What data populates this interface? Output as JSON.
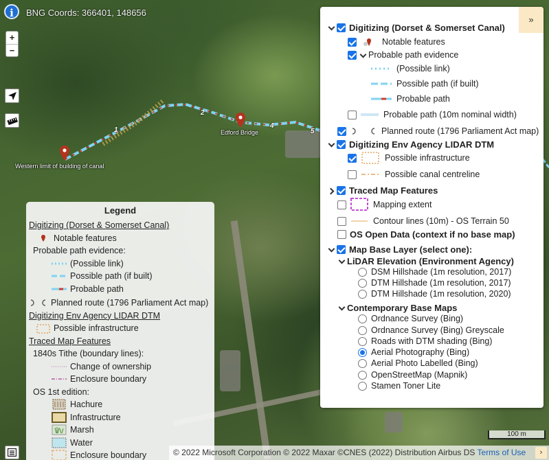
{
  "map": {
    "coords_text": "BNG Coords: 366401, 148656",
    "zoom_in": "+",
    "zoom_out": "−",
    "labels": {
      "western_limit": "Western limit of building of canal",
      "edford_bridge": "Edford Bridge"
    },
    "route_numbers": [
      "1",
      "2",
      "4",
      "5"
    ],
    "scale_label": "100 m",
    "attribution": "© 2022 Microsoft Corporation © 2022 Maxar ©CNES (2022) Distribution Airbus DS",
    "terms": "Terms of Use",
    "attribution_toggle": "›",
    "icons": [
      "info-icon",
      "locate-arrow-icon",
      "ruler-icon",
      "list-icon",
      "map-marker-icon"
    ],
    "colors": {
      "route_dash": "#cf3b2b",
      "path_cyan": "#7fd3f2",
      "marker": "#b3341f"
    }
  },
  "legend": {
    "title": "Legend",
    "sections": {
      "digitizing": "Digitizing (Dorset & Somerset Canal)",
      "notable": "Notable features",
      "probable_evidence": "Probable path evidence:",
      "possible_link": "(Possible link)",
      "possible_path": "Possible path (if built)",
      "probable_path": "Probable path",
      "planned_route": "Planned route (1796 Parliament Act map)",
      "ea_lidar": "Digitizing Env Agency LIDAR DTM",
      "possible_infra": "Possible infrastructure",
      "traced": "Traced Map Features",
      "tithe": "1840s Tithe (boundary lines):",
      "change_ownership": "Change of ownership",
      "enclosure_boundary": "Enclosure boundary",
      "os_1st": "OS 1st edition:",
      "hachure": "Hachure",
      "infrastructure": "Infrastructure",
      "marsh": "Marsh",
      "water": "Water",
      "enclosure_boundary_2": "Enclosure boundary"
    }
  },
  "layers": {
    "collapse": "»",
    "digitizing": {
      "label": "Digitizing (Dorset & Somerset Canal)",
      "checked": true
    },
    "notable": {
      "label": "Notable features",
      "checked": true
    },
    "probable_evidence": {
      "label": "Probable path evidence",
      "checked": true
    },
    "possible_link": "(Possible link)",
    "possible_path": "Possible path (if built)",
    "probable_path": "Probable path",
    "probable_path_10m": {
      "label": "Probable path (10m nominal width)",
      "checked": false
    },
    "planned_route": {
      "label": "Planned route (1796 Parliament Act map)",
      "checked": true
    },
    "ea_lidar": {
      "label": "Digitizing Env Agency LIDAR DTM",
      "checked": true
    },
    "possible_infra": {
      "label": "Possible infrastructure",
      "checked": true
    },
    "canal_centreline": {
      "label": "Possible canal centreline",
      "checked": false
    },
    "traced": {
      "label": "Traced Map Features",
      "checked": true
    },
    "mapping_extent": {
      "label": "Mapping extent",
      "checked": false
    },
    "contours": {
      "label": "Contour lines (10m) - OS Terrain 50",
      "checked": false
    },
    "os_open": {
      "label": "OS Open Data (context if no base map)",
      "checked": false
    },
    "base_layer": {
      "label": "Map Base Layer (select one):",
      "checked": true
    },
    "lidar_group": "LiDAR Elevation (Environment Agency)",
    "base_options": {
      "dsm_2017": "DSM Hillshade (1m resolution, 2017)",
      "dtm_2017": "DTM Hillshade (1m resolution, 2017)",
      "dtm_2020": "DTM Hillshade (1m resolution, 2020)",
      "contemporary_group": "Contemporary Base Maps",
      "os_bing": "Ordnance Survey (Bing)",
      "os_bing_grey": "Ordnance Survey (Bing) Greyscale",
      "roads_dtm": "Roads with DTM shading (Bing)",
      "aerial": "Aerial Photography (Bing)",
      "aerial_labelled": "Aerial Photo Labelled (Bing)",
      "osm": "OpenStreetMap (Mapnik)",
      "stamen": "Stamen Toner Lite"
    },
    "selected_base": "Aerial Photography (Bing)"
  }
}
